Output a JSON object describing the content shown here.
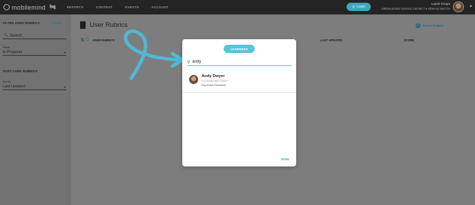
{
  "nav": {
    "logo_text": "mobilemind",
    "hq": "hq",
    "items": [
      "REPORTS",
      "CONTENT",
      "EVENTS",
      "ACCOUNT"
    ],
    "learn_button": "Learn",
    "user_name": "Laurie Knupa",
    "district": "GREEN ACRES SCHOOL DISTRICT",
    "district_sub": "VIEW HQ SWITCH"
  },
  "sidebar": {
    "filter_heading": "FILTER USER RUBRICS",
    "reset": "RESET",
    "search_placeholder": "Search",
    "status_label": "Status",
    "status_value": "In Progress",
    "sort_heading": "SORT USER RUBRICS",
    "sort_label": "Sort By",
    "sort_value": "Last Updated"
  },
  "main": {
    "title": "User Rubrics",
    "start_rubric": "START RUBRIC",
    "count": "0",
    "columns": [
      "USER RUBRICS",
      "LAST UPDATED",
      "SCORE"
    ]
  },
  "modal": {
    "tab": "LEARNERS",
    "search_value": "andy",
    "results": [
      {
        "name": "Andy Dwyer",
        "role": "**CLASSIFIED STAFF",
        "detail": "Org Event Personnel"
      }
    ],
    "done": "DONE"
  },
  "colors": {
    "accent": "#5bc3dc",
    "nav_bg": "#242424",
    "arrow": "#4fb8d6"
  }
}
